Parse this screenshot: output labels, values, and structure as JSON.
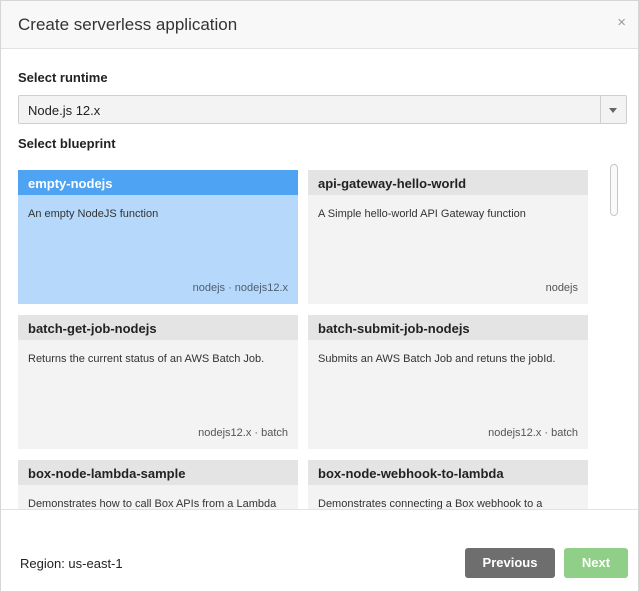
{
  "dialog": {
    "title": "Create serverless application",
    "close_label": "×"
  },
  "runtime": {
    "label": "Select runtime",
    "selected": "Node.js 12.x"
  },
  "blueprint": {
    "label": "Select blueprint",
    "cards": [
      {
        "title": "empty-nodejs",
        "description": "An empty NodeJS function",
        "tags": "nodejs · nodejs12.x",
        "selected": true
      },
      {
        "title": "api-gateway-hello-world",
        "description": "A Simple hello-world API Gateway function",
        "tags": "nodejs",
        "selected": false
      },
      {
        "title": "batch-get-job-nodejs",
        "description": "Returns the current status of an AWS Batch Job.",
        "tags": "nodejs12.x · batch",
        "selected": false
      },
      {
        "title": "batch-submit-job-nodejs",
        "description": "Submits an AWS Batch Job and retuns the jobId.",
        "tags": "nodejs12.x · batch",
        "selected": false
      },
      {
        "title": "box-node-lambda-sample",
        "description": "Demonstrates how to call Box APIs from a Lambda",
        "tags": "",
        "selected": false
      },
      {
        "title": "box-node-webhook-to-lambda",
        "description": "Demonstrates connecting a Box webhook to a",
        "tags": "",
        "selected": false
      }
    ]
  },
  "footer": {
    "region": "Region: us-east-1",
    "previous_label": "Previous",
    "next_label": "Next"
  },
  "colors": {
    "selected_header": "#4ea3f3",
    "selected_body": "#b6d9fb",
    "previous_button": "#6e6e6e",
    "next_button": "#8fcf87"
  }
}
